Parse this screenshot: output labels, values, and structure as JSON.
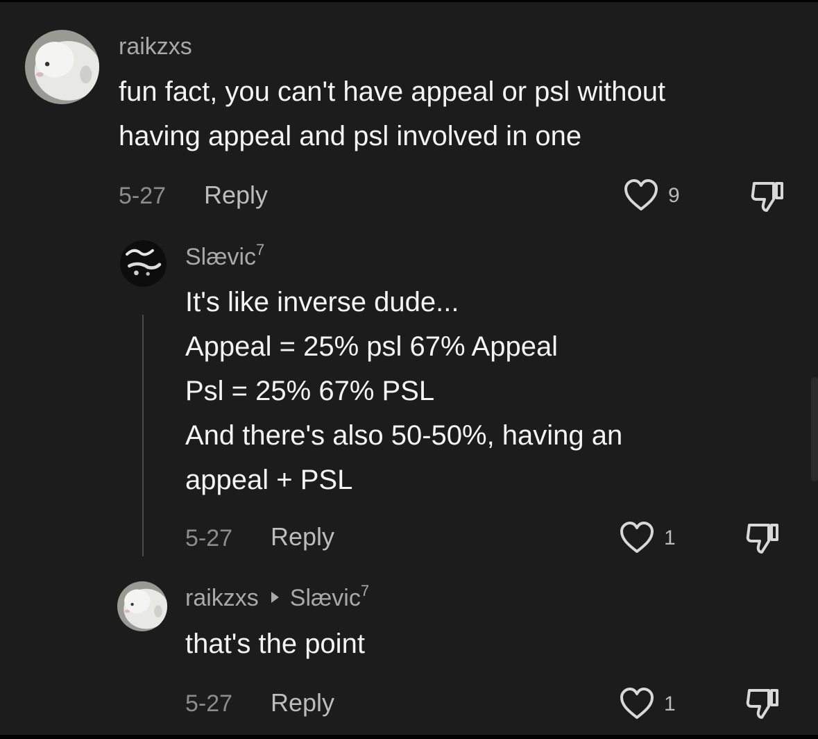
{
  "comments": [
    {
      "username": "raikzxs",
      "text_lines": [
        "fun fact, you can't have appeal or psl without",
        "having appeal and psl involved in one"
      ],
      "date": "5-27",
      "reply_label": "Reply",
      "likes": "9"
    },
    {
      "username": "Slævic",
      "username_sup": "7",
      "text_lines": [
        "It's like inverse dude...",
        "Appeal = 25% psl 67% Appeal",
        "Psl = 25% 67% PSL",
        "And there's also 50-50%, having an",
        "appeal + PSL"
      ],
      "date": "5-27",
      "reply_label": "Reply",
      "likes": "1"
    },
    {
      "username": "raikzxs",
      "reply_to": "Slævic",
      "reply_to_sup": "7",
      "text_lines": [
        "that's the point"
      ],
      "date": "5-27",
      "reply_label": "Reply",
      "likes": "1"
    }
  ],
  "icons": {
    "like": "heart-outline-icon",
    "dislike": "thumbs-down-icon",
    "reply_arrow": "play-arrow-icon"
  }
}
